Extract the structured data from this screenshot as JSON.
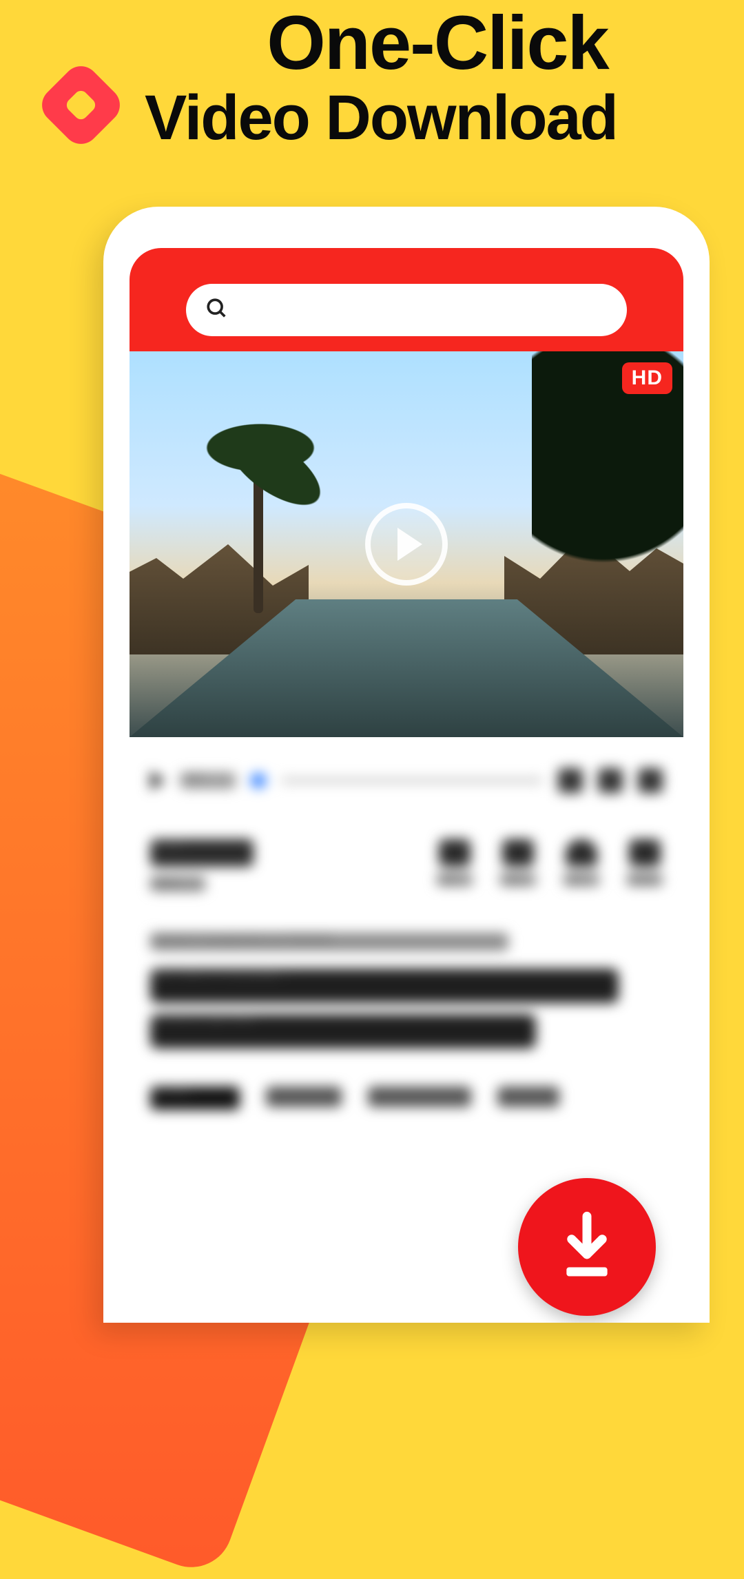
{
  "promo": {
    "headline_line1": "One-Click",
    "headline_line2": "Video Download",
    "logo_icon": "diamond-logo-icon"
  },
  "app": {
    "search": {
      "placeholder": ""
    },
    "video": {
      "hd_badge": "HD",
      "play_icon": "play-icon"
    },
    "player": {
      "time": "0:00",
      "volume_icon": "volume-icon",
      "fullscreen_icon": "fullscreen-icon",
      "pip_icon": "pip-icon"
    },
    "meta": {
      "views_value": "44,107",
      "views_label": "Views",
      "actions": [
        {
          "name": "add",
          "label": "Add"
        },
        {
          "name": "rate",
          "label": "Rate"
        },
        {
          "name": "like",
          "label": "Like"
        },
        {
          "name": "share",
          "label": "Share"
        }
      ]
    },
    "title": {
      "subheading": "Supasorn Suwajanakorn at TED2018",
      "line1": "Fake videos of real people —",
      "line2": "and how to spot them"
    },
    "tabs": [
      "Up next",
      "Details",
      "Transcript",
      "Related"
    ],
    "fab_icon": "download-icon"
  }
}
